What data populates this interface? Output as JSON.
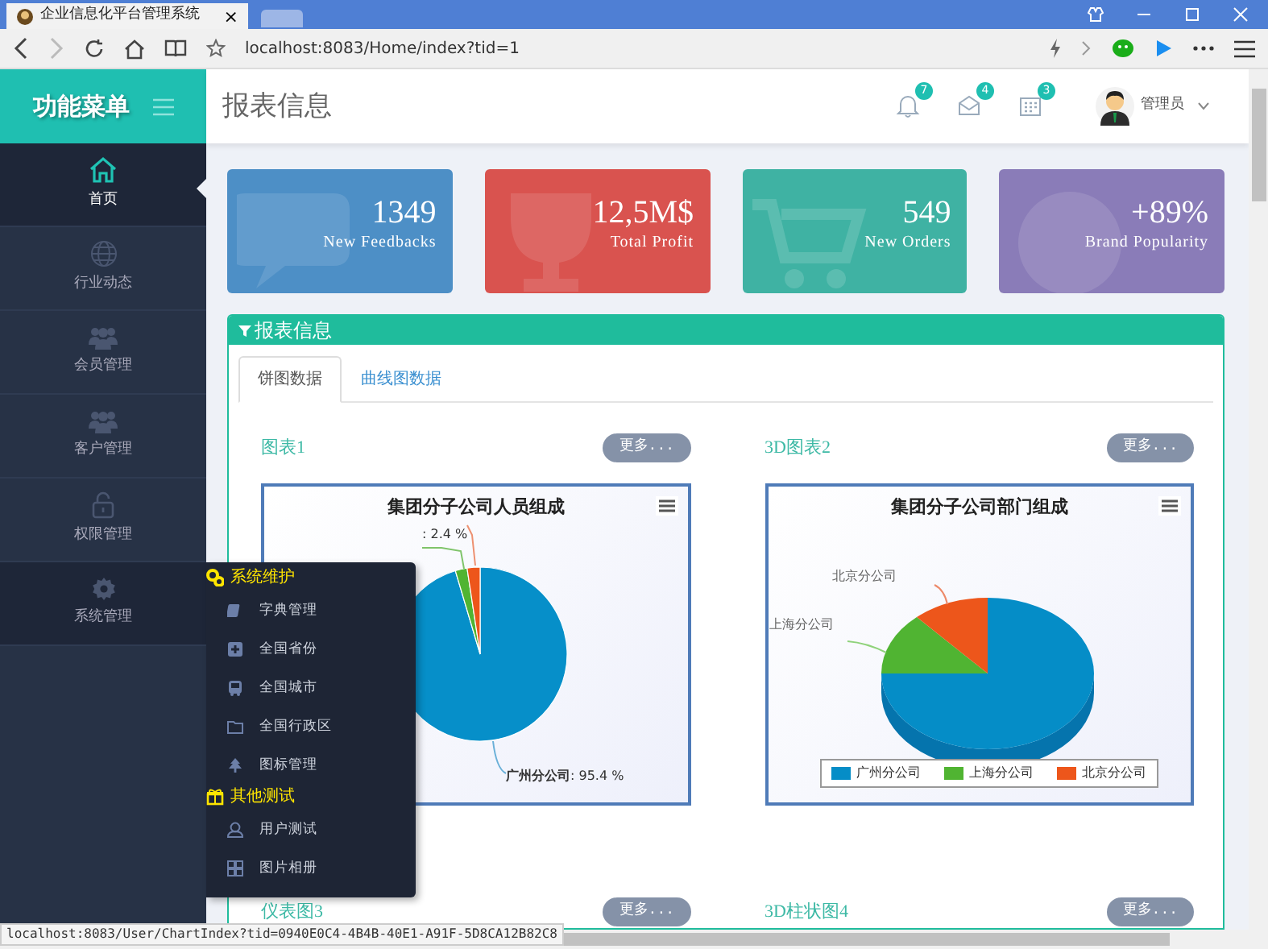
{
  "browser": {
    "tab_title": "企业信息化平台管理系统",
    "tab_close": "×",
    "url": "localhost:8083/Home/index?tid=1",
    "status_url": "localhost:8083/User/ChartIndex?tid=0940E0C4-4B4B-40E1-A91F-5D8CA12B82C8"
  },
  "sidebar": {
    "title": "功能菜单",
    "items": [
      {
        "label": "首页",
        "selected": true,
        "open": false
      },
      {
        "label": "行业动态",
        "selected": false,
        "open": false
      },
      {
        "label": "会员管理",
        "selected": false,
        "open": false
      },
      {
        "label": "客户管理",
        "selected": false,
        "open": false
      },
      {
        "label": "权限管理",
        "selected": false,
        "open": false
      },
      {
        "label": "系统管理",
        "selected": false,
        "open": true
      }
    ]
  },
  "submenu": {
    "groups": [
      {
        "title": "系统维护",
        "items": [
          "字典管理",
          "全国省份",
          "全国城市",
          "全国行政区",
          "图标管理"
        ]
      },
      {
        "title": "其他测试",
        "items": [
          "用户测试",
          "图片相册"
        ]
      }
    ]
  },
  "header": {
    "title": "报表信息",
    "notifications": [
      {
        "count": "7"
      },
      {
        "count": "4"
      },
      {
        "count": "3"
      }
    ],
    "user": "管理员"
  },
  "stats": [
    {
      "value": "1349",
      "label": "New Feedbacks",
      "color": "#4d8fc6"
    },
    {
      "value": "12,5M$",
      "label": "Total Profit",
      "color": "#d9534f"
    },
    {
      "value": "549",
      "label": "New Orders",
      "color": "#3fb2a3"
    },
    {
      "value": "+89%",
      "label": "Brand Popularity",
      "color": "#8a7cb8"
    }
  ],
  "panel": {
    "title": "报表信息",
    "tabs": [
      {
        "label": "饼图数据",
        "selected": true
      },
      {
        "label": "曲线图数据",
        "selected": false
      }
    ],
    "charts": [
      {
        "heading": "图表1",
        "more": "更多...",
        "title": "集团分子公司人员组成",
        "labels": [
          {
            "value": ": 2.4 %"
          },
          {
            "name": "广州分公司",
            "value": ": 95.4 %"
          }
        ],
        "chart_data": {
          "type": "pie",
          "values": [
            95.4,
            2.2,
            2.4
          ],
          "colors": [
            "#068fc9",
            "#50b432",
            "#ed561b"
          ]
        }
      },
      {
        "heading": "3D图表2",
        "more": "更多...",
        "title": "集团分子公司部门组成",
        "slice_labels": [
          "北京分公司",
          "上海分公司"
        ],
        "legend": [
          {
            "name": "广州分公司",
            "color": "#058dc7"
          },
          {
            "name": "上海分公司",
            "color": "#50b432"
          },
          {
            "name": "北京分公司",
            "color": "#ed561b"
          }
        ]
      },
      {
        "heading": "仪表图3",
        "more": "更多..."
      },
      {
        "heading": "3D柱状图4",
        "more": "更多..."
      }
    ]
  }
}
